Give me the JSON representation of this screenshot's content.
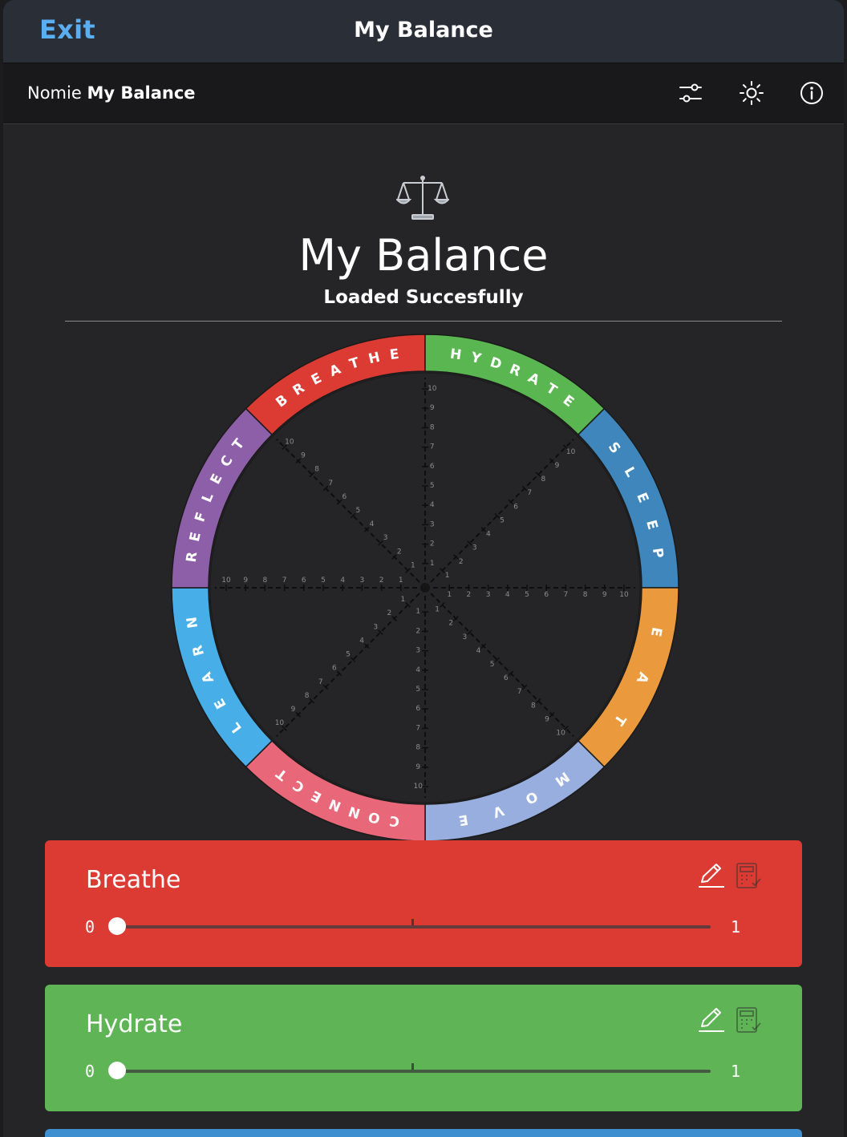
{
  "navbar": {
    "exit_label": "Exit",
    "title": "My Balance"
  },
  "toolbar": {
    "app_prefix": "Nomie",
    "app_name": "My Balance",
    "icons": [
      "settings-sliders-icon",
      "brightness-icon",
      "info-icon"
    ]
  },
  "header": {
    "icon": "scale-icon",
    "title": "My Balance",
    "status": "Loaded Succesfully"
  },
  "wheel": {
    "segments": [
      {
        "label": "BREATHE",
        "color": "#dc3b34"
      },
      {
        "label": "HYDRATE",
        "color": "#5ab651"
      },
      {
        "label": "SLEEP",
        "color": "#3e86bc"
      },
      {
        "label": "EAT",
        "color": "#ea9a3c"
      },
      {
        "label": "MOVE",
        "color": "#97aede"
      },
      {
        "label": "CONNECT",
        "color": "#e8687a"
      },
      {
        "label": "LEARN",
        "color": "#48aee8"
      },
      {
        "label": "REFLECT",
        "color": "#8d5fa8"
      }
    ],
    "scale_max": 10
  },
  "cards": [
    {
      "label": "Breathe",
      "min": "0",
      "max": "1",
      "value": 0,
      "color": "#dc3b34",
      "icons": [
        "edit-icon",
        "calculator-icon"
      ]
    },
    {
      "label": "Hydrate",
      "min": "0",
      "max": "1",
      "value": 0,
      "color": "#5fb456",
      "icons": [
        "edit-icon",
        "calculator-icon"
      ]
    }
  ]
}
